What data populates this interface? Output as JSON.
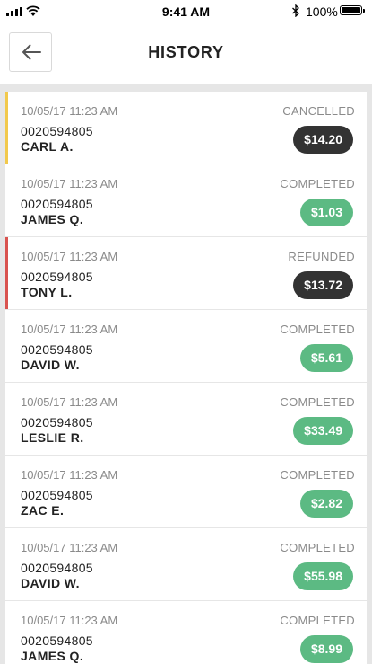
{
  "status_bar": {
    "time": "9:41 AM",
    "battery_percent": "100%",
    "icons": [
      "signal-icon",
      "wifi-icon",
      "bluetooth-icon",
      "battery-icon"
    ]
  },
  "header": {
    "title": "HISTORY",
    "back_icon": "arrow-left-icon"
  },
  "colors": {
    "completed": "#5cba83",
    "neutral": "#333333",
    "cancelled_flag": "#f2c94c",
    "refunded_flag": "#d9534f"
  },
  "transactions": [
    {
      "date": "10/05/17 11:23 AM",
      "id": "0020594805",
      "name": "CARL A.",
      "status": "CANCELLED",
      "amount": "$14.20"
    },
    {
      "date": "10/05/17 11:23 AM",
      "id": "0020594805",
      "name": "JAMES Q.",
      "status": "COMPLETED",
      "amount": "$1.03"
    },
    {
      "date": "10/05/17 11:23 AM",
      "id": "0020594805",
      "name": "TONY L.",
      "status": "REFUNDED",
      "amount": "$13.72"
    },
    {
      "date": "10/05/17 11:23 AM",
      "id": "0020594805",
      "name": "DAVID W.",
      "status": "COMPLETED",
      "amount": "$5.61"
    },
    {
      "date": "10/05/17 11:23 AM",
      "id": "0020594805",
      "name": "LESLIE R.",
      "status": "COMPLETED",
      "amount": "$33.49"
    },
    {
      "date": "10/05/17 11:23 AM",
      "id": "0020594805",
      "name": "ZAC E.",
      "status": "COMPLETED",
      "amount": "$2.82"
    },
    {
      "date": "10/05/17 11:23 AM",
      "id": "0020594805",
      "name": "DAVID W.",
      "status": "COMPLETED",
      "amount": "$55.98"
    },
    {
      "date": "10/05/17 11:23 AM",
      "id": "0020594805",
      "name": "JAMES Q.",
      "status": "COMPLETED",
      "amount": "$8.99"
    }
  ]
}
